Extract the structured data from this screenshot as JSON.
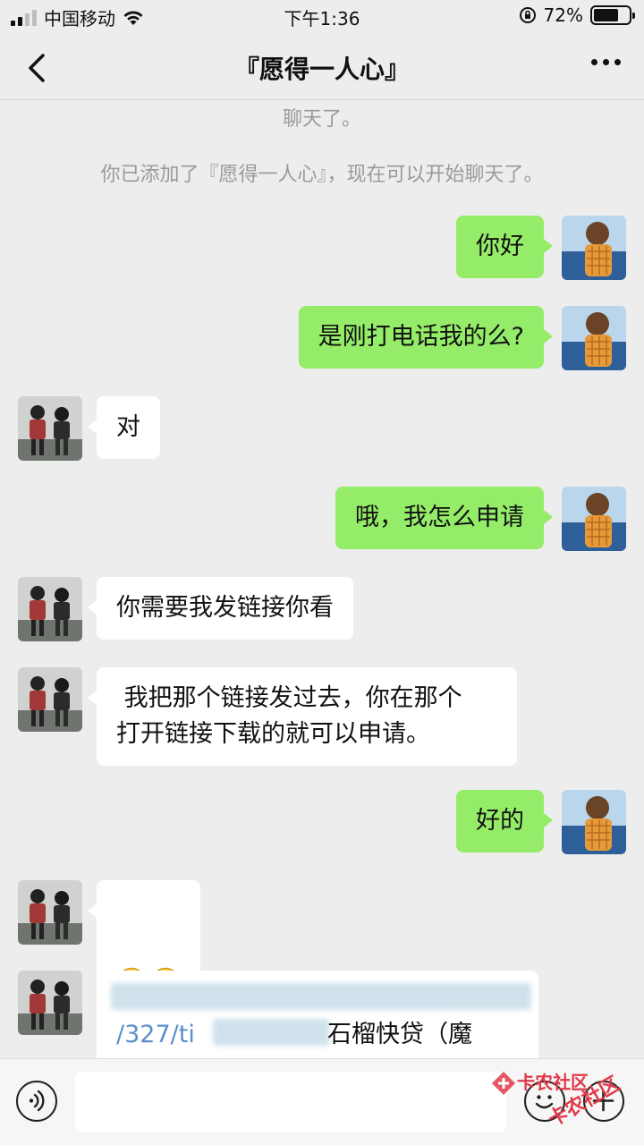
{
  "status_bar": {
    "carrier": "中国移动",
    "time": "下午1:36",
    "battery_percent": "72%",
    "battery_level": 0.72,
    "icons": [
      "signal-icon",
      "wifi-icon",
      "rotation-lock-icon",
      "battery-icon"
    ]
  },
  "nav": {
    "title": "『愿得一人心』",
    "back_icon": "chevron-left-icon",
    "more_icon": "more-dots-icon"
  },
  "system_messages": [
    "聊天了。",
    "你已添加了『愿得一人心』，现在可以开始聊天了。"
  ],
  "messages": [
    {
      "side": "right",
      "text": "你好"
    },
    {
      "side": "right",
      "text": "是刚打电话我的么?"
    },
    {
      "side": "left",
      "text": "对"
    },
    {
      "side": "right",
      "text": "哦，我怎么申请"
    },
    {
      "side": "left",
      "text": "你需要我发链接你看"
    },
    {
      "side": "left",
      "text": " 我把那个链接发过去，你在那个\n打开链接下载的就可以申请。"
    },
    {
      "side": "right",
      "text": "好的"
    },
    {
      "side": "left",
      "emoji": [
        "smile-emoji",
        "smile-emoji"
      ]
    },
    {
      "side": "left",
      "link_prefix": "/327/ti",
      "link_text": "石榴快贷（魔"
    }
  ],
  "input_bar": {
    "voice_icon": "voice-icon",
    "emoji_icon": "emoji-icon",
    "plus_icon": "plus-icon",
    "input_value": ""
  },
  "watermark": {
    "line1": "卡农社区",
    "line2": "卡农社区",
    "brand_color": "#e0394a"
  },
  "colors": {
    "sent_bubble": "#95ec69",
    "received_bubble": "#ffffff",
    "background": "#ededed"
  }
}
